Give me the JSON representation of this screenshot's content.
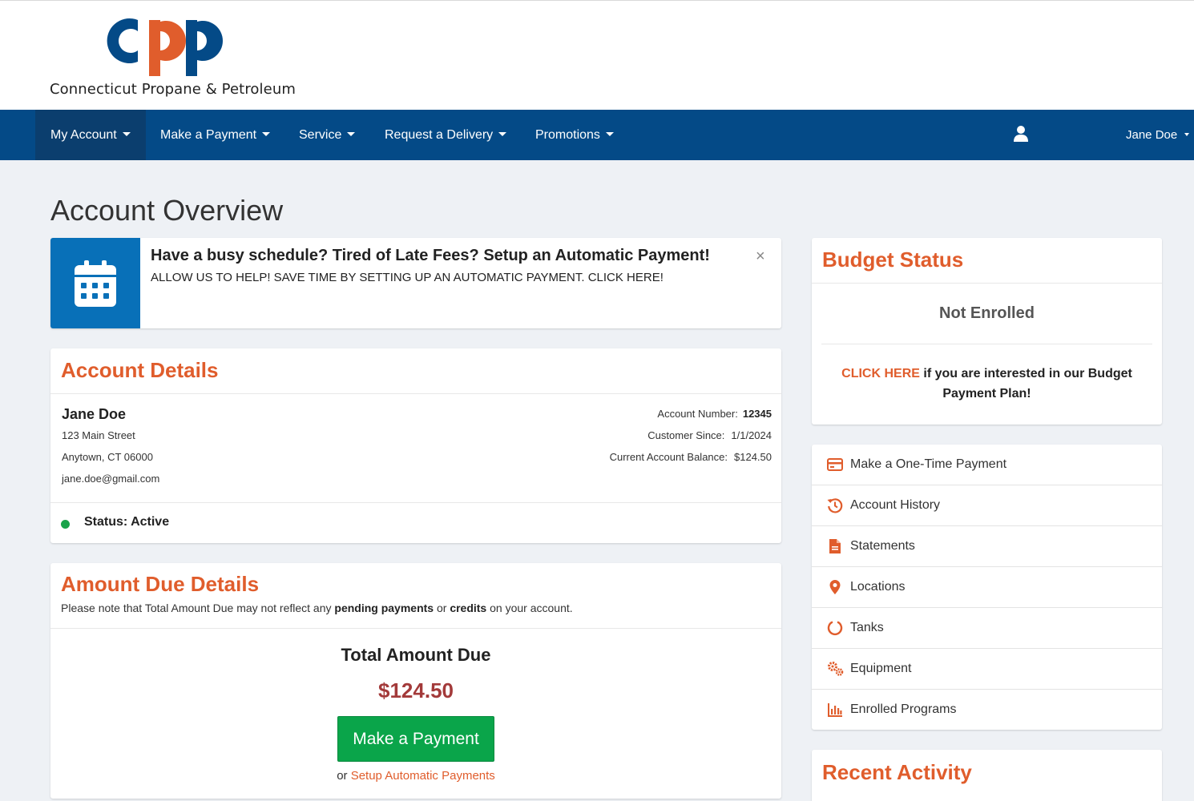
{
  "header": {
    "logo_text": "Connecticut Propane & Petroleum",
    "logo_colors": {
      "blue": "#044a87",
      "orange": "#e05d2c"
    }
  },
  "nav": {
    "items": [
      {
        "label": "My Account"
      },
      {
        "label": "Make a Payment"
      },
      {
        "label": "Service"
      },
      {
        "label": "Request a Delivery"
      },
      {
        "label": "Promotions"
      }
    ],
    "user_icon": "user-icon",
    "user_name": "Jane Doe"
  },
  "page_title": "Account Overview",
  "promo": {
    "icon": "calendar-icon",
    "title": "Have a busy schedule? Tired of Late Fees? Setup an Automatic Payment!",
    "subtitle": "ALLOW US TO HELP! SAVE TIME BY SETTING UP AN AUTOMATIC PAYMENT. CLICK HERE!",
    "close": "×"
  },
  "account_details": {
    "title": "Account Details",
    "name": "Jane Doe",
    "street": "123 Main Street",
    "city": "Anytown, CT 06000",
    "email": "jane.doe@gmail.com",
    "account_number_label": "Account Number:",
    "account_number": "12345",
    "customer_since_label": "Customer Since:",
    "customer_since": "1/1/2024",
    "balance_label": "Current Account Balance:",
    "balance": "$124.50",
    "status": "Status: Active",
    "status_color": "#1aa34a"
  },
  "amount_due": {
    "title": "Amount Due Details",
    "note_pre": "Please note that Total Amount Due may not reflect any",
    "note_b1": "pending payments",
    "note_mid": "or",
    "note_b2": "credits",
    "note_post": "on your account.",
    "total_label": "Total Amount Due",
    "total": "$124.50",
    "pay_button": "Make a Payment",
    "or_text": "or",
    "auto_link": "Setup Automatic Payments"
  },
  "budget": {
    "title": "Budget Status",
    "status": "Not Enrolled",
    "click_here": "CLICK HERE",
    "message": "if you are interested in our Budget Payment Plan!"
  },
  "quick_links": [
    {
      "icon": "credit-card-icon",
      "label": "Make a One-Time Payment"
    },
    {
      "icon": "history-icon",
      "label": "Account History"
    },
    {
      "icon": "document-icon",
      "label": "Statements"
    },
    {
      "icon": "map-marker-icon",
      "label": "Locations"
    },
    {
      "icon": "circle-notch-icon",
      "label": "Tanks"
    },
    {
      "icon": "cogs-icon",
      "label": "Equipment"
    },
    {
      "icon": "bar-chart-icon",
      "label": "Enrolled Programs"
    }
  ],
  "recent_activity": {
    "title": "Recent Activity"
  }
}
